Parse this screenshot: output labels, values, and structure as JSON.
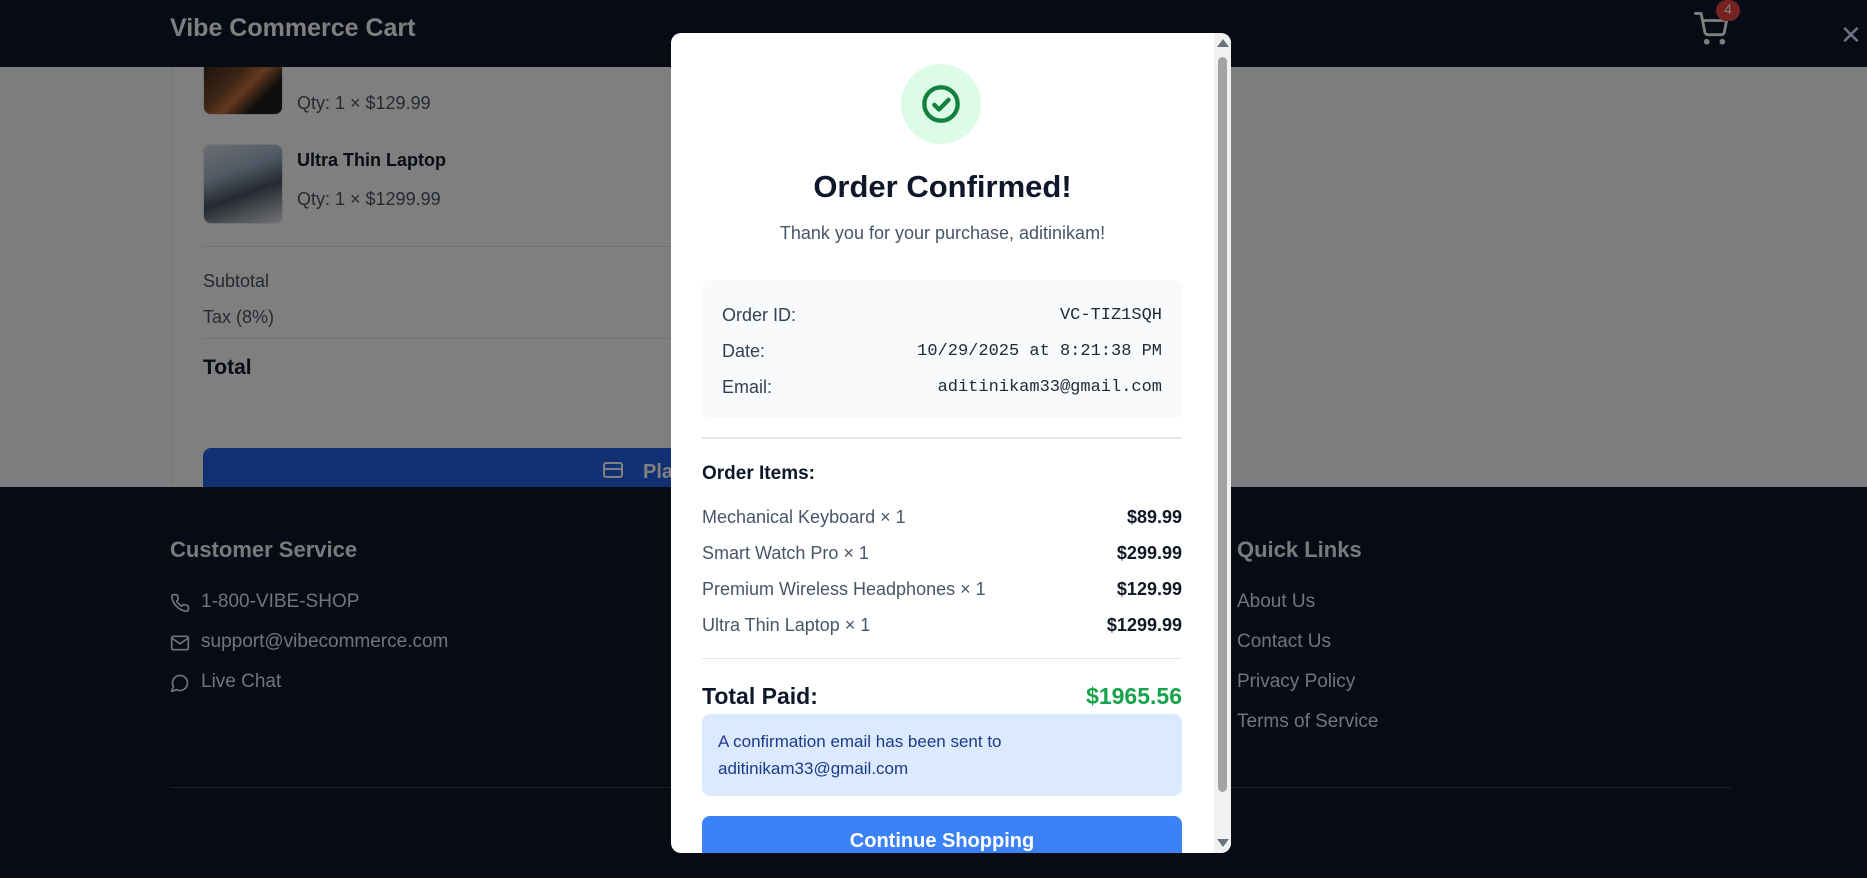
{
  "header": {
    "brand": "Vibe Commerce Cart",
    "cart_count": "4"
  },
  "cart_summary": {
    "items": [
      {
        "name": "",
        "qty": "Qty: 1 × $129.99"
      },
      {
        "name": "Ultra Thin Laptop",
        "qty": "Qty: 1 × $1299.99"
      }
    ],
    "subtotal_label": "Subtotal",
    "tax_label": "Tax (8%)",
    "total_label": "Total",
    "place_button": "Pla"
  },
  "footer": {
    "customer_service": {
      "heading": "Customer Service",
      "phone": "1-800-VIBE-SHOP",
      "email": "support@vibecommerce.com",
      "chat": "Live Chat"
    },
    "quick_links": {
      "heading": "Quick Links",
      "links": [
        "About Us",
        "Contact Us",
        "Privacy Policy",
        "Terms of Service"
      ]
    }
  },
  "modal": {
    "title": "Order Confirmed!",
    "subtitle": "Thank you for your purchase, aditinikam!",
    "details": [
      {
        "label": "Order ID:",
        "value": "VC-TIZ1SQH"
      },
      {
        "label": "Date:",
        "value": "10/29/2025 at 8:21:38 PM"
      },
      {
        "label": "Email:",
        "value": "aditinikam33@gmail.com"
      }
    ],
    "items_heading": "Order Items:",
    "items": [
      {
        "name": "Mechanical Keyboard × 1",
        "price": "$89.99"
      },
      {
        "name": "Smart Watch Pro × 1",
        "price": "$299.99"
      },
      {
        "name": "Premium Wireless Headphones × 1",
        "price": "$129.99"
      },
      {
        "name": "Ultra Thin Laptop × 1",
        "price": "$1299.99"
      }
    ],
    "total_label": "Total Paid:",
    "total_value": "$1965.56",
    "email_notice": "A confirmation email has been sent to aditinikam33@gmail.com",
    "continue_button": "Continue Shopping"
  },
  "colors": {
    "nav_bg": "#0f172a",
    "primary": "#3b82f6",
    "success": "#16a34a",
    "badge": "#ef4444"
  }
}
